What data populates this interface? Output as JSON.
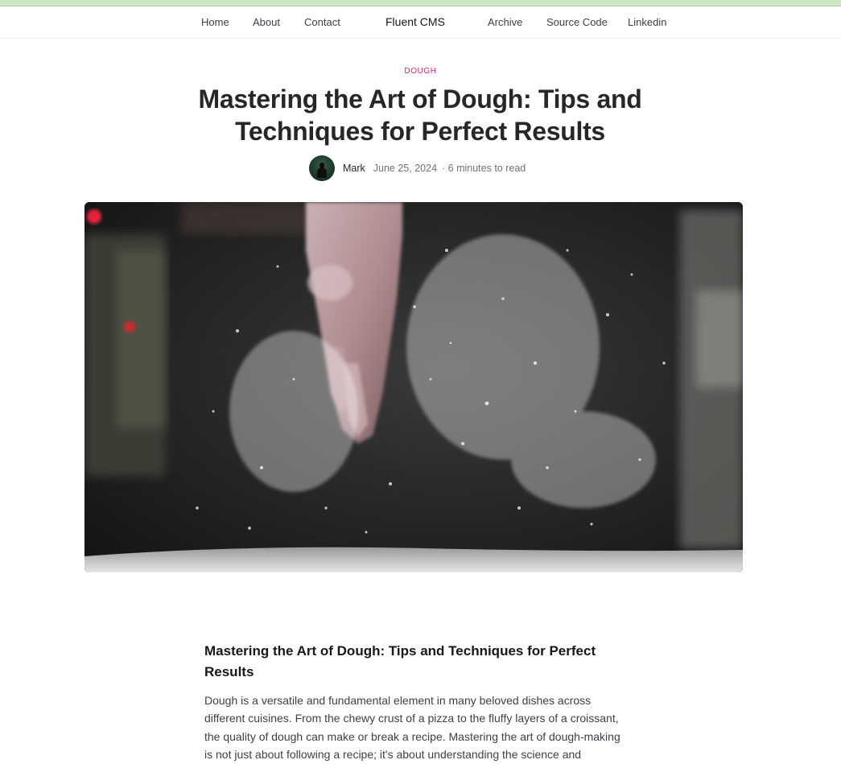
{
  "nav": {
    "home": "Home",
    "about": "About",
    "contact": "Contact",
    "brand": "Fluent CMS",
    "archive": "Archive",
    "source_code": "Source Code",
    "linkedin": "Linkedin"
  },
  "post": {
    "category": "DOUGH",
    "title": "Mastering the Art of Dough: Tips and Techniques for Perfect Results",
    "author": "Mark",
    "date": "June 25, 2024",
    "read_time": "· 6 minutes to read",
    "hero_image": "flour-dusted-hand-photo"
  },
  "article": {
    "heading": "Mastering the Art of Dough: Tips and Techniques for Perfect Results",
    "intro": "Dough is a versatile and fundamental element in many beloved dishes across different cuisines. From the chewy crust of a pizza to the fluffy layers of a croissant, the quality of dough can make or break a recipe. Mastering the art of dough-making is not just about following a recipe; it's about understanding the science and"
  },
  "colors": {
    "accent_category": "#db2777",
    "topbar": "#cde8c8"
  }
}
